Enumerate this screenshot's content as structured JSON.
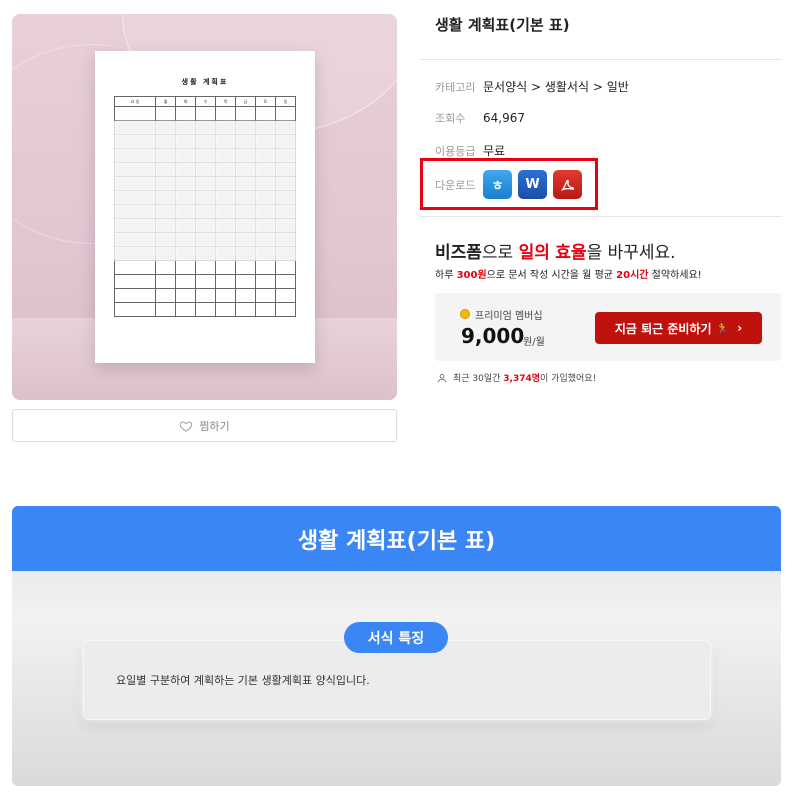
{
  "preview": {
    "paper_title": "생활 계획표",
    "days": [
      "요 일",
      "월",
      "화",
      "수",
      "목",
      "금",
      "토",
      "일"
    ]
  },
  "wishlist": {
    "label": "찜하기",
    "icon": "heart-icon"
  },
  "product": {
    "title": "생활 계획표(기본 표)",
    "category_label": "카테고리",
    "category_value": "문서양식 > 생활서식 > 일반",
    "views_label": "조회수",
    "views_value": "64,967",
    "grade_label": "이용등급",
    "grade_value": "무료",
    "download_label": "다운로드",
    "download_icons": [
      "hwp-icon",
      "word-icon",
      "pdf-icon"
    ],
    "hwp_glyph": "ㅎ",
    "word_glyph": "W"
  },
  "promo": {
    "h_brand": "비즈폼",
    "h_part1": "으로 ",
    "h_red1": "일의",
    "h_space": " ",
    "h_red2": "효율",
    "h_part2": "을 바꾸세요.",
    "s_part1": "하루 ",
    "s_red1": "300원",
    "s_part2": "으로 문서 작성 시간을 월 평균 ",
    "s_red2": "20시간",
    "s_part3": " 절약하세요!",
    "membership": "프리미엄 멤버십",
    "price": "9,000",
    "price_unit": "원/월",
    "cta": "지금 퇴근 준비하기",
    "join_part1": "최근 30일간 ",
    "join_count": "3,374명",
    "join_part2": "이 가입했어요!"
  },
  "banner": {
    "title": "생활 계획표(기본 표)",
    "feature_pill": "서식 특징",
    "feature_text": "요일별 구분하여 계획하는 기본 생활계획표 양식입니다."
  },
  "colors": {
    "accent_red": "#e60012",
    "brand_blue": "#3a86f5",
    "cta_red": "#c0120c"
  }
}
